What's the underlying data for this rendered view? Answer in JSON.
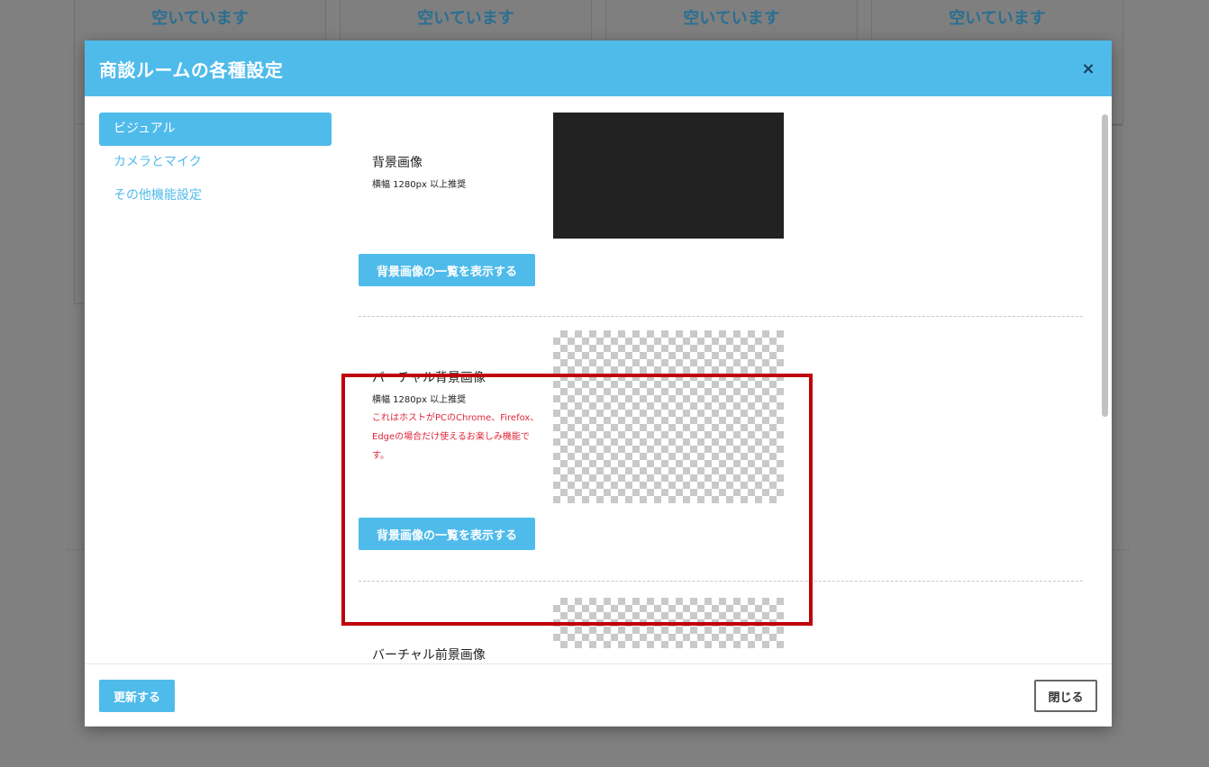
{
  "background": {
    "cards": [
      {
        "title": "空いています"
      },
      {
        "title": "空いています"
      },
      {
        "title": "空いています"
      },
      {
        "title": "空いています"
      }
    ]
  },
  "modal": {
    "title": "商談ルームの各種設定",
    "close_symbol": "×",
    "sidebar": {
      "items": [
        {
          "label": "ビジュアル",
          "active": true
        },
        {
          "label": "カメラとマイク",
          "active": false
        },
        {
          "label": "その他機能設定",
          "active": false
        }
      ]
    },
    "sections": {
      "background_image": {
        "title": "背景画像",
        "subtitle": "横幅 1280px 以上推奨",
        "button": "背景画像の一覧を表示する"
      },
      "virtual_background": {
        "title": "バーチャル背景画像",
        "subtitle": "横幅 1280px 以上推奨",
        "note": "これはホストがPCのChrome、Firefox、Edgeの場合だけ使えるお楽しみ機能です。",
        "button": "背景画像の一覧を表示する"
      },
      "virtual_foreground": {
        "title": "バーチャル前景画像"
      }
    },
    "footer": {
      "update_label": "更新する",
      "close_label": "閉じる"
    }
  },
  "colors": {
    "accent": "#4fbbeb",
    "highlight_border": "#c0000b",
    "note_text": "#e0263a"
  }
}
